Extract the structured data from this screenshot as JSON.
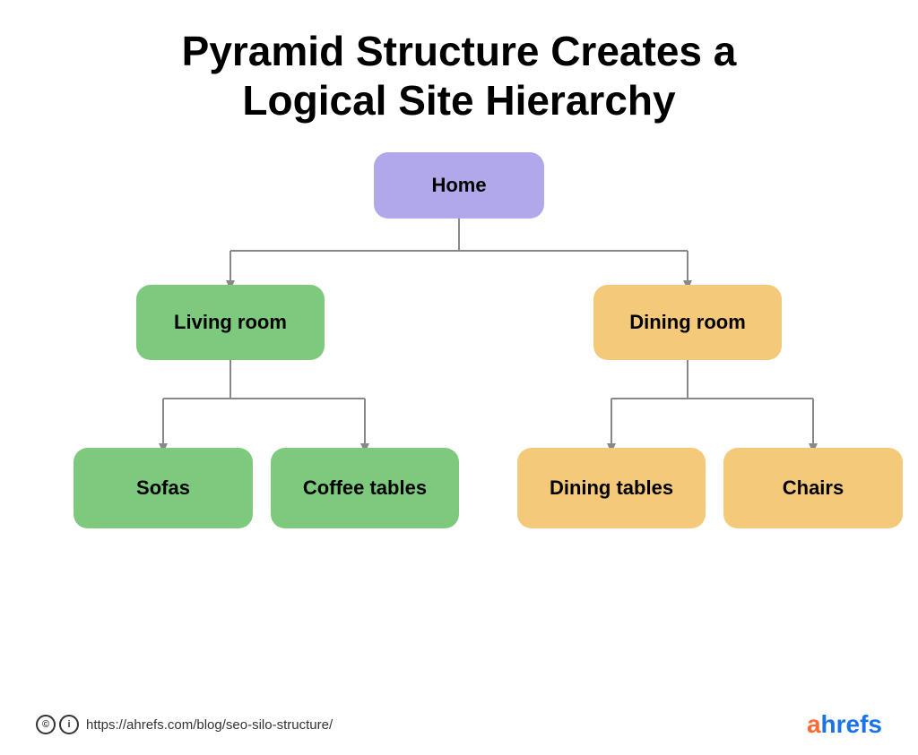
{
  "title": {
    "line1": "Pyramid Structure Creates a",
    "line2": "Logical Site Hierarchy"
  },
  "nodes": {
    "home": "Home",
    "living_room": "Living room",
    "dining_room": "Dining room",
    "sofas": "Sofas",
    "coffee_tables": "Coffee tables",
    "dining_tables": "Dining tables",
    "chairs": "Chairs"
  },
  "footer": {
    "url": "https://ahrefs.com/blog/seo-silo-structure/",
    "brand_a": "a",
    "brand_rest": "hrefs"
  },
  "colors": {
    "home_bg": "#b0a8e8",
    "living_bg": "#7dc97d",
    "dining_bg": "#f5c97a",
    "connector": "#888888"
  }
}
